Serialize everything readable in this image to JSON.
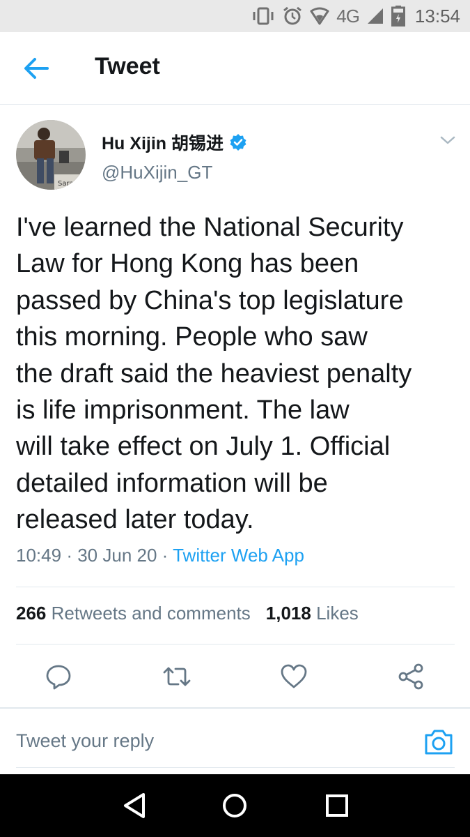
{
  "status_bar": {
    "network": "4G",
    "time": "13:54"
  },
  "header": {
    "title": "Tweet"
  },
  "author": {
    "name": "Hu Xijin 胡锡进",
    "handle": "@HuXijin_GT",
    "avatar_caption": "Saraje"
  },
  "tweet": {
    "text": "I've learned the National Security\nLaw for Hong Kong has been\npassed by China's top legislature\nthis morning. People who saw\nthe draft said the heaviest penalty\nis life imprisonment. The law\nwill take effect on July 1. Official\ndetailed information will be\nreleased later today.",
    "time": "10:49",
    "date": "30 Jun 20",
    "separator": "·",
    "source": "Twitter Web App"
  },
  "stats": {
    "retweets_count": "266",
    "retweets_label": "Retweets and comments",
    "likes_count": "1,018",
    "likes_label": "Likes"
  },
  "reply": {
    "placeholder": "Tweet your reply"
  },
  "colors": {
    "accent": "#1da1f2",
    "secondary_text": "#657786",
    "primary_text": "#14171a",
    "divider": "#e1e8ed"
  },
  "icons": {
    "back": "arrow-left-icon",
    "verified": "verified-badge-icon",
    "more": "chevron-down-icon",
    "reply": "comment-icon",
    "retweet": "retweet-icon",
    "like": "heart-icon",
    "share": "share-icon",
    "camera": "camera-icon"
  }
}
